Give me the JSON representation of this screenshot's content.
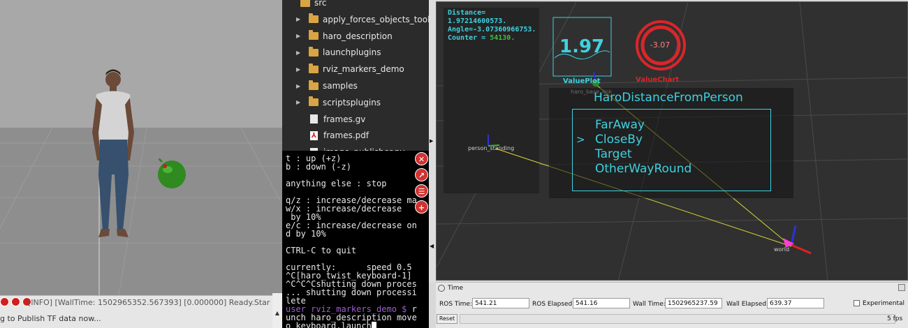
{
  "gazebo": {
    "status_info": "[INFO] [WallTime: 1502965352.567393] [0.000000] Ready.Star",
    "status_msg": "g to Publish TF data now...",
    "toolbar": [
      "record-icon",
      "stop-icon",
      "eye-icon"
    ]
  },
  "file_tree": {
    "items": [
      {
        "label": "src",
        "type": "folder",
        "arrow": "none"
      },
      {
        "label": "apply_forces_objects_tools",
        "type": "folder",
        "arrow": "collapsed"
      },
      {
        "label": "haro_description",
        "type": "folder",
        "arrow": "collapsed"
      },
      {
        "label": "launchplugins",
        "type": "folder",
        "arrow": "collapsed"
      },
      {
        "label": "rviz_markers_demo",
        "type": "folder",
        "arrow": "collapsed"
      },
      {
        "label": "samples",
        "type": "folder",
        "arrow": "collapsed"
      },
      {
        "label": "scriptsplugins",
        "type": "folder",
        "arrow": "collapsed"
      },
      {
        "label": "frames.gv",
        "type": "file",
        "arrow": "none"
      },
      {
        "label": "frames.pdf",
        "type": "pdf",
        "arrow": "none"
      },
      {
        "label": "image_publisher.py",
        "type": "file",
        "arrow": "none"
      }
    ]
  },
  "terminal": {
    "lines": [
      "t : up (+z)",
      "b : down (-z)",
      "",
      "anything else : stop",
      "",
      "q/z : increase/decrease ma",
      "w/x : increase/decrease",
      " by 10%",
      "e/c : increase/decrease on",
      "d by 10%",
      "",
      "CTRL-C to quit",
      "",
      "currently:      speed 0.5",
      "^C[haro_twist_keyboard-1]",
      "^C^C^Cshutting down proces",
      "... shutting down processi",
      "lete"
    ],
    "prompt_user": "user rviz_markers_demo $",
    "prompt_cmd": " r",
    "after_lines": [
      "unch haro_description move",
      "o_keyboard.launch"
    ],
    "tools": [
      {
        "name": "close-terminal-icon",
        "glyph": "✕"
      },
      {
        "name": "external-link-icon",
        "glyph": "↗"
      },
      {
        "name": "list-icon",
        "glyph": "☰"
      },
      {
        "name": "add-terminal-icon",
        "glyph": "+"
      }
    ]
  },
  "rviz": {
    "overlay_distance_label": "Distance=",
    "overlay_distance_value": "1.97214600573.",
    "overlay_angle": "Angle=-3.07360966753.",
    "overlay_counter_label": "Counter = ",
    "overlay_counter_value": "54130.",
    "value_plot_value": "1.97",
    "value_plot_label": "ValuePlot",
    "value_chart_value": "-3.07",
    "value_chart_label": "ValueChart",
    "frame_haro": "haro_base_link",
    "frame_person": "person_standing",
    "frame_world": "world",
    "menu_title": "HaroDistanceFromPerson",
    "menu_items": [
      "FarAway",
      "CloseBy",
      "Target",
      "OtherWayRound"
    ],
    "menu_selected_index": 1,
    "menu_cursor": ">",
    "colors": {
      "cyan": "#3fd1e0",
      "red": "#d8262a",
      "green": "#3ac23a"
    }
  },
  "time_panel": {
    "title": "Time",
    "ros_time_label": "ROS Time:",
    "ros_time": "541.21",
    "ros_elapsed_label": "ROS Elapsed:",
    "ros_elapsed": "541.16",
    "wall_time_label": "Wall Time:",
    "wall_time": "1502965237.59",
    "wall_elapsed_label": "Wall Elapsed:",
    "wall_elapsed": "639.37",
    "experimental_label": "Experimental",
    "reset_label": "Reset",
    "fps": "5 fps"
  }
}
